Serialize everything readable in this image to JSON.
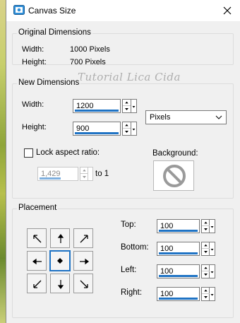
{
  "window": {
    "title": "Canvas Size"
  },
  "original_dimensions": {
    "group_label": "Original Dimensions",
    "width_label": "Width:",
    "width_value": "1000 Pixels",
    "height_label": "Height:",
    "height_value": "700 Pixels"
  },
  "watermark": "Tutorial Lica Cida",
  "new_dimensions": {
    "group_label": "New Dimensions",
    "width_label": "Width:",
    "width_value": "1200",
    "height_label": "Height:",
    "height_value": "900",
    "units_selected": "Pixels",
    "lock_label": "Lock aspect ratio:",
    "lock_checked": false,
    "ratio_value": "1,429",
    "ratio_suffix": "to 1",
    "background_label": "Background:"
  },
  "placement": {
    "group_label": "Placement",
    "grid": [
      "top-left",
      "top",
      "top-right",
      "left",
      "center",
      "right",
      "bottom-left",
      "bottom",
      "bottom-right"
    ],
    "selected": "center",
    "top_label": "Top:",
    "top_value": "100",
    "bottom_label": "Bottom:",
    "bottom_value": "100",
    "left_label": "Left:",
    "left_value": "100",
    "right_label": "Right:",
    "right_value": "100"
  },
  "colors": {
    "accent": "#1f73c4",
    "dialog_bg": "#f0f0f0",
    "no_background_icon": "#9a9a9a"
  },
  "icons": {
    "app": "canvas-app-icon",
    "close": "close-icon",
    "background": "no-background-icon"
  }
}
